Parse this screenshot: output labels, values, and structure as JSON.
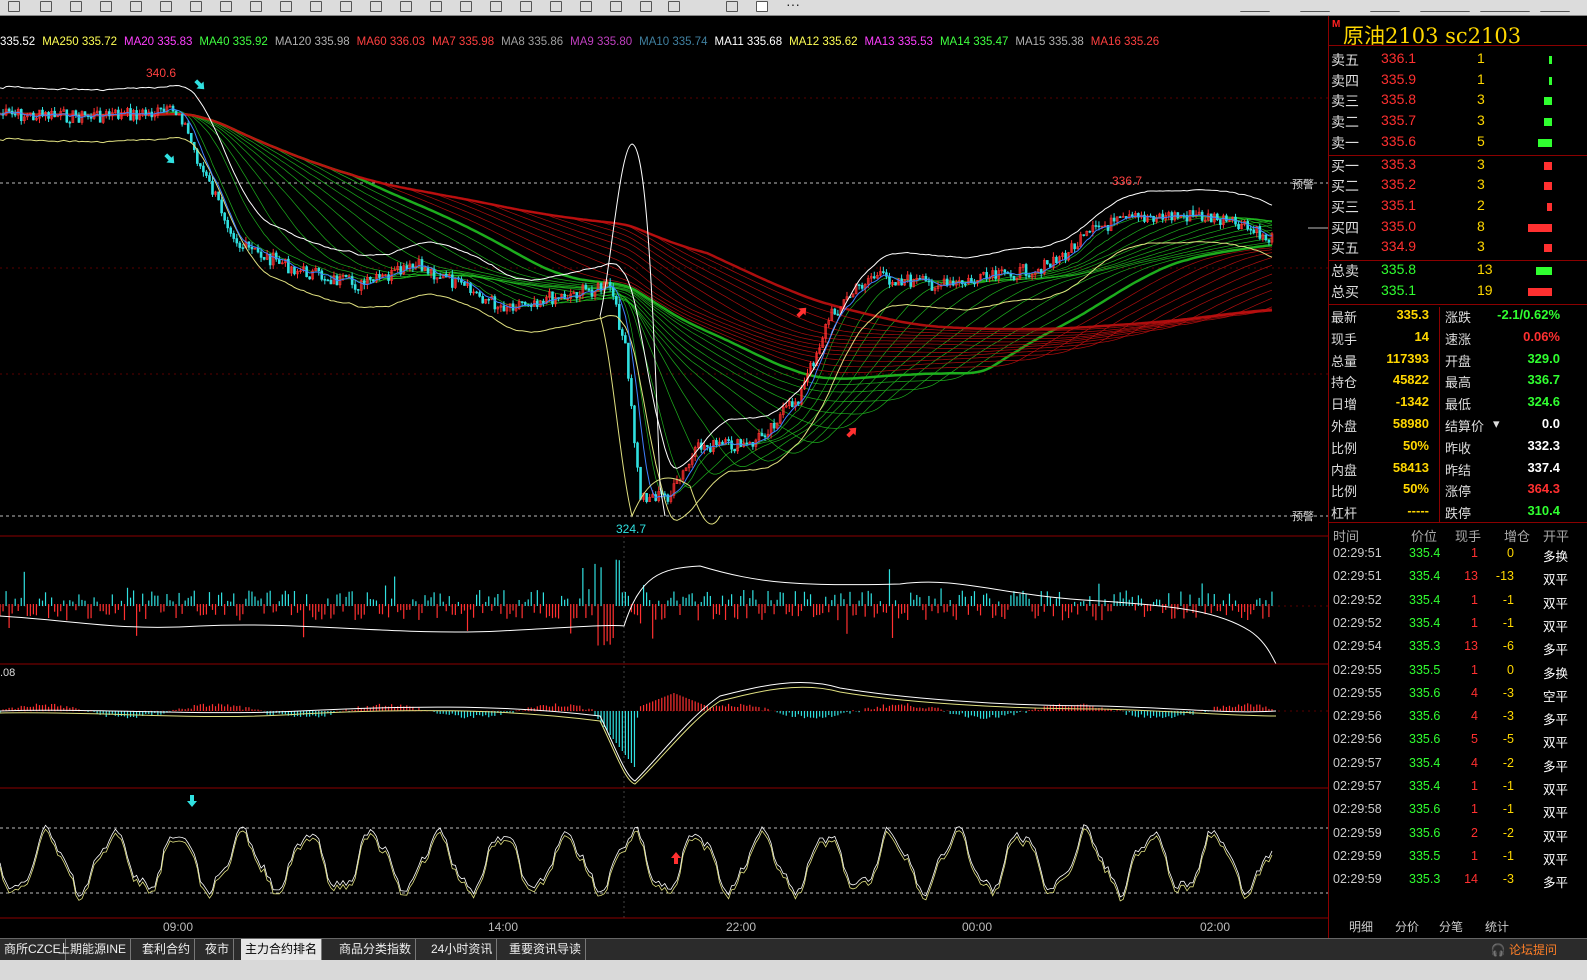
{
  "ma_legend": [
    {
      "text": "335.52",
      "color": "#ffffff"
    },
    {
      "text": "MA250 335.72",
      "color": "#ffff55"
    },
    {
      "text": "MA20 335.83",
      "color": "#ff40ff"
    },
    {
      "text": "MA40 335.92",
      "color": "#40ff40"
    },
    {
      "text": "MA120 335.98",
      "color": "#b0b0b0"
    },
    {
      "text": "MA60 336.03",
      "color": "#ff4040"
    },
    {
      "text": "MA7 335.98",
      "color": "#ff4040"
    },
    {
      "text": "MA8 335.86",
      "color": "#a0a0a0"
    },
    {
      "text": "MA9 335.80",
      "color": "#c040c0"
    },
    {
      "text": "MA10 335.74",
      "color": "#4080a0"
    },
    {
      "text": "MA11 335.68",
      "color": "#ffffff"
    },
    {
      "text": "MA12 335.62",
      "color": "#ffff55"
    },
    {
      "text": "MA13 335.53",
      "color": "#ff40ff"
    },
    {
      "text": "MA14 335.47",
      "color": "#40ff40"
    },
    {
      "text": "MA15 335.38",
      "color": "#b0b0b0"
    },
    {
      "text": "MA16 335.26",
      "color": "#ff4040"
    }
  ],
  "chart_labels": {
    "high_label": "340.6",
    "right_high": "336.7",
    "low_label": "324.7",
    "macd_label": ".08",
    "alert_upper": "预警",
    "alert_lower": "预警"
  },
  "time_axis": [
    "09:00",
    "14:00",
    "22:00",
    "00:00",
    "02:00"
  ],
  "quote": {
    "badge": "M",
    "title": "原油2103  sc2103",
    "sells": [
      {
        "label": "卖五",
        "price": "336.1",
        "vol": "1",
        "bar": 3
      },
      {
        "label": "卖四",
        "price": "335.9",
        "vol": "1",
        "bar": 3
      },
      {
        "label": "卖三",
        "price": "335.8",
        "vol": "3",
        "bar": 8
      },
      {
        "label": "卖二",
        "price": "335.7",
        "vol": "3",
        "bar": 8
      },
      {
        "label": "卖一",
        "price": "335.6",
        "vol": "5",
        "bar": 14
      }
    ],
    "buys": [
      {
        "label": "买一",
        "price": "335.3",
        "vol": "3",
        "bar": 8
      },
      {
        "label": "买二",
        "price": "335.2",
        "vol": "3",
        "bar": 8
      },
      {
        "label": "买三",
        "price": "335.1",
        "vol": "2",
        "bar": 5
      },
      {
        "label": "买四",
        "price": "335.0",
        "vol": "8",
        "bar": 24
      },
      {
        "label": "买五",
        "price": "334.9",
        "vol": "3",
        "bar": 8
      }
    ],
    "totals": [
      {
        "label": "总卖",
        "price": "335.8",
        "vol": "13",
        "bar": 16
      },
      {
        "label": "总买",
        "price": "335.1",
        "vol": "19",
        "bar": 24
      }
    ],
    "stats_left": [
      {
        "label": "最新",
        "value": "335.3",
        "color": "#ffd700"
      },
      {
        "label": "现手",
        "value": "14",
        "color": "#ffd700"
      },
      {
        "label": "总量",
        "value": "117393",
        "color": "#ffd700"
      },
      {
        "label": "持仓",
        "value": "45822",
        "color": "#ffd700"
      },
      {
        "label": "日增",
        "value": "-1342",
        "color": "#ffd700"
      },
      {
        "label": "外盘",
        "value": "58980",
        "color": "#ffd700"
      },
      {
        "label": "比例",
        "value": "50%",
        "color": "#ffd700"
      },
      {
        "label": "内盘",
        "value": "58413",
        "color": "#ffd700"
      },
      {
        "label": "比例",
        "value": "50%",
        "color": "#ffd700"
      },
      {
        "label": "杠杆",
        "value": "-----",
        "color": "#ffd700"
      }
    ],
    "stats_right": [
      {
        "label": "涨跌",
        "value": "-2.1/0.62%",
        "color": "#30ff30"
      },
      {
        "label": "速涨",
        "value": "0.06%",
        "color": "#ff3030"
      },
      {
        "label": "开盘",
        "value": "329.0",
        "color": "#30ff30"
      },
      {
        "label": "最高",
        "value": "336.7",
        "color": "#30ff30"
      },
      {
        "label": "最低",
        "value": "324.6",
        "color": "#30ff30"
      },
      {
        "label": "结算价",
        "value": "0.0",
        "color": "#ffffff"
      },
      {
        "label": "昨收",
        "value": "332.3",
        "color": "#ffffff"
      },
      {
        "label": "昨结",
        "value": "337.4",
        "color": "#ffffff"
      },
      {
        "label": "涨停",
        "value": "364.3",
        "color": "#ff3030"
      },
      {
        "label": "跌停",
        "value": "310.4",
        "color": "#30ff30"
      }
    ],
    "settle_arrow": "▾",
    "ticks_header": [
      "时间",
      "价位",
      "现手",
      "增仓",
      "开平"
    ],
    "ticks": [
      {
        "time": "02:29:51",
        "price": "335.4",
        "vol": "1",
        "chg": "0",
        "type": "多换"
      },
      {
        "time": "02:29:51",
        "price": "335.4",
        "vol": "13",
        "chg": "-13",
        "type": "双平"
      },
      {
        "time": "02:29:52",
        "price": "335.4",
        "vol": "1",
        "chg": "-1",
        "type": "双平"
      },
      {
        "time": "02:29:52",
        "price": "335.4",
        "vol": "1",
        "chg": "-1",
        "type": "双平"
      },
      {
        "time": "02:29:54",
        "price": "335.3",
        "vol": "13",
        "chg": "-6",
        "type": "多平"
      },
      {
        "time": "02:29:55",
        "price": "335.5",
        "vol": "1",
        "chg": "0",
        "type": "多换"
      },
      {
        "time": "02:29:55",
        "price": "335.6",
        "vol": "4",
        "chg": "-3",
        "type": "空平"
      },
      {
        "time": "02:29:56",
        "price": "335.6",
        "vol": "4",
        "chg": "-3",
        "type": "多平"
      },
      {
        "time": "02:29:56",
        "price": "335.6",
        "vol": "5",
        "chg": "-5",
        "type": "双平"
      },
      {
        "time": "02:29:57",
        "price": "335.4",
        "vol": "4",
        "chg": "-2",
        "type": "多平"
      },
      {
        "time": "02:29:57",
        "price": "335.4",
        "vol": "1",
        "chg": "-1",
        "type": "双平"
      },
      {
        "time": "02:29:58",
        "price": "335.6",
        "vol": "1",
        "chg": "-1",
        "type": "双平"
      },
      {
        "time": "02:29:59",
        "price": "335.6",
        "vol": "2",
        "chg": "-2",
        "type": "双平"
      },
      {
        "time": "02:29:59",
        "price": "335.5",
        "vol": "1",
        "chg": "-1",
        "type": "双平"
      },
      {
        "time": "02:29:59",
        "price": "335.3",
        "vol": "14",
        "chg": "-3",
        "type": "多平"
      }
    ],
    "tabs": [
      "明细",
      "分价",
      "分笔",
      "统计"
    ]
  },
  "bottom_tabs": [
    {
      "label": "商所CZCE",
      "active": false
    },
    {
      "label": "上期能源INE",
      "active": false
    },
    {
      "label": "套利合约",
      "active": false
    },
    {
      "label": "夜市",
      "active": false
    },
    {
      "label": "主力合约排名",
      "active": true
    },
    {
      "label": "商品分类指数",
      "active": false
    },
    {
      "label": "24小时资讯",
      "active": false
    },
    {
      "label": "重要资讯导读",
      "active": false
    }
  ],
  "forum_link": "论坛提问",
  "topbar_more": "···",
  "colors": {
    "up": "#ff3030",
    "down": "#30e0e0",
    "green": "#30ff30",
    "gold": "#ffd700",
    "border": "#8b0000"
  }
}
